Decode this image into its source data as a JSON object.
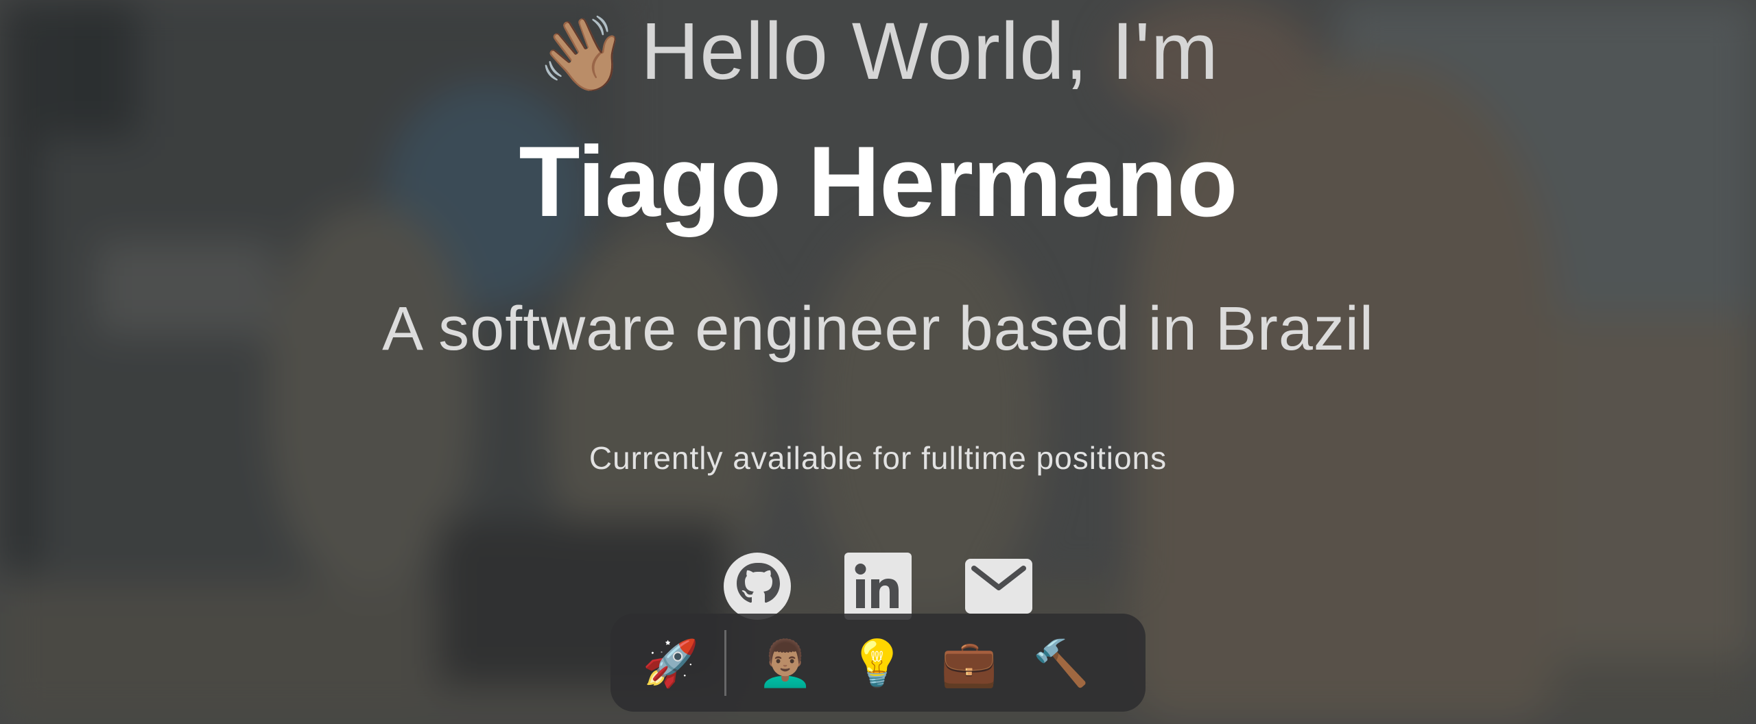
{
  "hero": {
    "wave_emoji": "👋🏽",
    "greeting": "Hello World, I'm",
    "name": "Tiago Hermano",
    "tagline": "A software engineer based in Brazil",
    "availability": "Currently available for fulltime positions"
  },
  "socials": [
    {
      "icon": "github-icon"
    },
    {
      "icon": "linkedin-icon"
    },
    {
      "icon": "mail-icon"
    }
  ],
  "dock": {
    "items": [
      {
        "icon": "rocket-icon",
        "glyph": "🚀"
      },
      {
        "icon": "avatar-icon",
        "glyph": "👨🏽‍🦱"
      },
      {
        "icon": "lightbulb-icon",
        "glyph": "💡"
      },
      {
        "icon": "briefcase-icon",
        "glyph": "💼"
      },
      {
        "icon": "hammer-icon",
        "glyph": "🔨"
      }
    ]
  },
  "colors": {
    "name": "#ffffff",
    "text": "#dcdcdc",
    "icon": "#e6e6e6",
    "dock_bg": "#2d2e30"
  }
}
